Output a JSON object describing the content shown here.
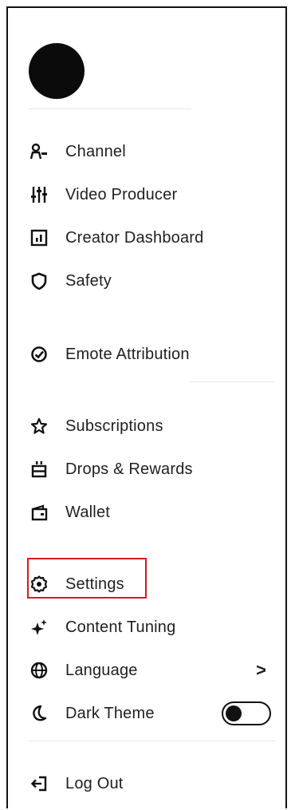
{
  "menu": {
    "items": [
      {
        "label": "Channel",
        "icon": "channel-icon"
      },
      {
        "label": "Video Producer",
        "icon": "sliders-icon"
      },
      {
        "label": "Creator Dashboard",
        "icon": "dashboard-icon"
      },
      {
        "label": "Safety",
        "icon": "shield-icon"
      },
      {
        "label": "Emote Attribution",
        "icon": "emote-attribution-icon"
      },
      {
        "label": "Subscriptions",
        "icon": "star-icon"
      },
      {
        "label": "Drops & Rewards",
        "icon": "drops-icon"
      },
      {
        "label": "Wallet",
        "icon": "wallet-icon"
      },
      {
        "label": "Settings",
        "icon": "gear-icon"
      },
      {
        "label": "Content Tuning",
        "icon": "sparkle-icon"
      },
      {
        "label": "Language",
        "icon": "globe-icon",
        "chevron": ">"
      },
      {
        "label": "Dark Theme",
        "icon": "moon-icon",
        "toggle": false
      },
      {
        "label": "Log Out",
        "icon": "logout-icon"
      }
    ]
  },
  "highlight_color": "#e0151f"
}
